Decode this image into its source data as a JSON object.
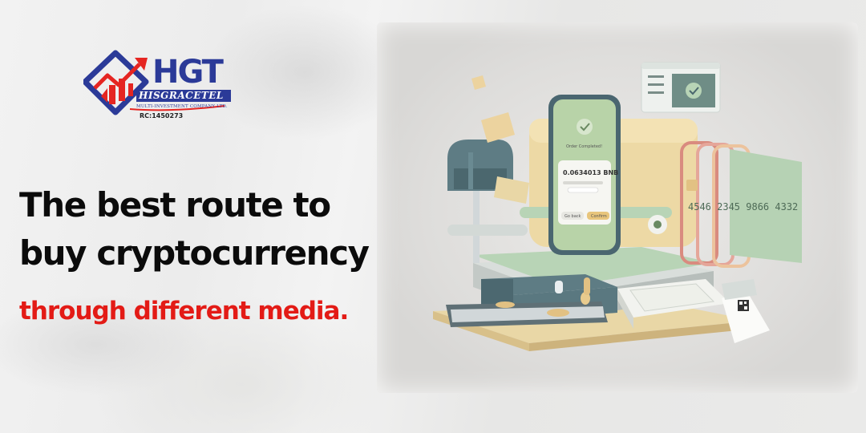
{
  "logo": {
    "brand": "HGT",
    "name": "HISGRACETEL",
    "company": "MULTI-INVESTMENT COMPANY LTD.",
    "rc": "RC:1450273"
  },
  "headline": {
    "line1": "The best route to",
    "line2": "buy cryptocurrency",
    "subline": "through different media."
  },
  "illustration": {
    "phone_status": "Order Completed!",
    "phone_amount": "0.0634013 BNB",
    "phone_button_left": "Go back",
    "phone_button_right": "Confirm",
    "card_number": "4546 2345 9866 4332"
  },
  "colors": {
    "headline": "#0b0b0b",
    "subline": "#e31b16",
    "logo_blue": "#2b3a98",
    "logo_red": "#e52521"
  }
}
